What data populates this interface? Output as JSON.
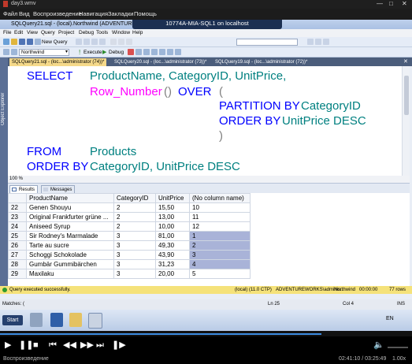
{
  "player": {
    "title": "day3.wmv",
    "menu": [
      "Файл",
      "Вид",
      "Воспроизведение",
      "Навигация",
      "Закладки",
      "Помощь"
    ],
    "status_text": "Воспроизведение",
    "time_text": "02:41:10 / 03:25:49",
    "speed": "1.00x",
    "progress": 0.78
  },
  "rdp": {
    "title": "10774A-MIA-SQL1 on localhost"
  },
  "ssms": {
    "title": "SQLQuery21.sql - (local).Northwind (ADVENTUREWORKS\\administrator (74))*",
    "menu": [
      "File",
      "Edit",
      "View",
      "Query",
      "Project",
      "Debug",
      "Tools",
      "Window",
      "Help"
    ],
    "new_query": "New Query",
    "database": "Northwind",
    "execute": "Execute",
    "debug": "Debug",
    "tabs": [
      "SQLQuery21.sql - (loc...\\administrator (74))*",
      "SQLQuery20.sql - (loc...\\administrator (73))*",
      "SQLQuery19.sql - (loc...\\administrator (72))*"
    ],
    "object_explorer": "Object Explorer",
    "zoom": "100 %"
  },
  "editor": {
    "l1_select": "SELECT",
    "l1_cols": "ProductName, CategoryID, UnitPrice,",
    "l2_fn": "Row_Number",
    "l2_paren": "() ",
    "l2_over": "OVER",
    "l2_open": "(",
    "l3_partition": "PARTITION BY",
    "l3_col": "CategoryID",
    "l4_order": "ORDER BY",
    "l4_col": "UnitPrice DESC",
    "l5_close": ")",
    "l6_from": "FROM",
    "l6_tbl": "Products",
    "l7_order": "ORDER BY",
    "l7_cols": "CategoryID, UnitPrice DESC"
  },
  "results": {
    "tab_results": "Results",
    "tab_messages": "Messages",
    "columns": [
      "ProductName",
      "CategoryID",
      "UnitPrice",
      "(No column name)"
    ],
    "rows": [
      [
        "22",
        "Genen Shouyu",
        "2",
        "15,50",
        "10"
      ],
      [
        "23",
        "Original Frankfurter grüne ...",
        "2",
        "13,00",
        "11"
      ],
      [
        "24",
        "Aniseed Syrup",
        "2",
        "10,00",
        "12"
      ],
      [
        "25",
        "Sir Rodney's Marmalade",
        "3",
        "81,00",
        "1"
      ],
      [
        "26",
        "Tarte au sucre",
        "3",
        "49,30",
        "2"
      ],
      [
        "27",
        "Schoggi Schokolade",
        "3",
        "43,90",
        "3"
      ],
      [
        "28",
        "Gumbär Gummibärchen",
        "3",
        "31,23",
        "4"
      ],
      [
        "29",
        "Maxilaku",
        "3",
        "20,00",
        "5"
      ]
    ]
  },
  "status": {
    "message": "Query executed successfully.",
    "server": "(local) (11.0 CTP)",
    "user": "ADVENTUREWORKS\\adminis...",
    "db": "Northwind",
    "time": "00:00:00",
    "rows": "77 rows",
    "matches": "Matches: (",
    "ln": "Ln 25",
    "col": "Col 4",
    "ins": "INS"
  },
  "taskbar": {
    "start": "Start",
    "lang": "EN"
  }
}
